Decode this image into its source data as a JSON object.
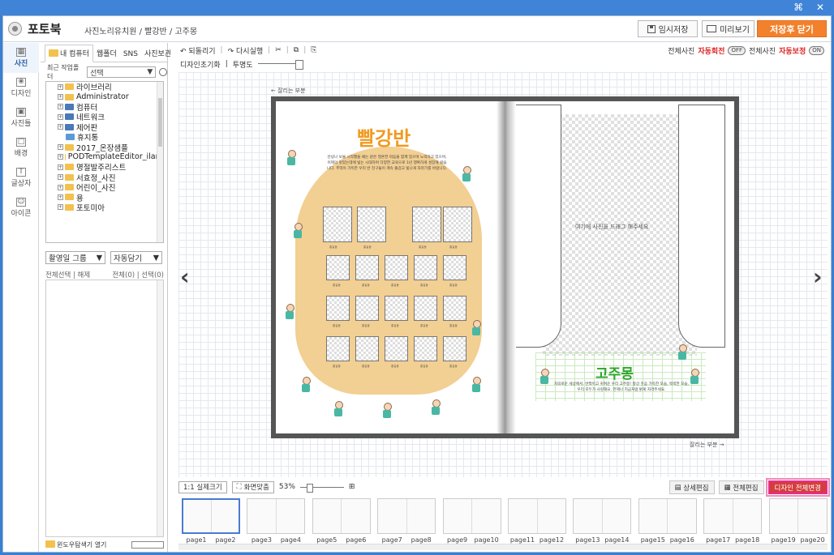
{
  "window": {
    "controls": "⌘ ✕"
  },
  "header": {
    "app_title": "포토북",
    "breadcrumb": "사진노리유치원 / 빨강반 / 고주몽",
    "temp_save": "임시저장",
    "preview": "미리보기",
    "save_close": "저장후 닫기"
  },
  "rail": [
    {
      "label": "사진",
      "icon": "photo-icon",
      "glyph": "▦"
    },
    {
      "label": "디자인",
      "icon": "design-icon",
      "glyph": "❀"
    },
    {
      "label": "사진틀",
      "icon": "frame-icon",
      "glyph": "▣"
    },
    {
      "label": "배경",
      "icon": "background-icon",
      "glyph": "□"
    },
    {
      "label": "글상자",
      "icon": "textbox-icon",
      "glyph": "T"
    },
    {
      "label": "아이콘",
      "icon": "emoji-icon",
      "glyph": "☺"
    }
  ],
  "filepanel": {
    "tabs": [
      "내 컴퓨터",
      "웹폴더",
      "SNS",
      "사진보관함"
    ],
    "recent_label": "최근 작업폴더",
    "recent_value": "선택",
    "tree": [
      {
        "label": "라이브러리",
        "type": "folder"
      },
      {
        "label": "Administrator",
        "type": "user"
      },
      {
        "label": "컴퓨터",
        "type": "pc"
      },
      {
        "label": "네트워크",
        "type": "network"
      },
      {
        "label": "제어판",
        "type": "control"
      },
      {
        "label": "휴지통",
        "type": "trash"
      },
      {
        "label": "2017_온장샘플",
        "type": "folder"
      },
      {
        "label": "PODTemplateEditor_ilark",
        "type": "folder"
      },
      {
        "label": "명절발주리스트",
        "type": "folder"
      },
      {
        "label": "서효정_사진",
        "type": "folder"
      },
      {
        "label": "어린이_사진",
        "type": "folder"
      },
      {
        "label": "용",
        "type": "folder"
      },
      {
        "label": "포토미아",
        "type": "folder"
      }
    ],
    "group_select": "촬영일 그룹",
    "auto_fill": "자동담기",
    "select_all": "전체선택 | 해제",
    "select_count": "전체(0) | 선택(0)",
    "footer_label": "윈도우탐색기 열기"
  },
  "editor": {
    "undo": "되돌리기",
    "redo": "다시실행",
    "auto_rotate_label": "전체사진",
    "auto_rotate_red": "자동회전",
    "auto_rotate_state": "OFF",
    "auto_correct_label": "전체사진",
    "auto_correct_red": "자동보정",
    "auto_correct_state": "ON",
    "design_reset": "디자인초기화",
    "transparency": "투명도",
    "bleed_top": "← 잘리는 부분",
    "bleed_bottom": "잘리는 부분 →",
    "left_page": {
      "title": "빨강반",
      "story": "안녕나 보물 시작했을 때는 같은 영혼한 마음을 함께 있으며 노력하고 있으며, 이제의 멋있는데에 빛는 시대하며 다양한 교육으로 1년 행복하게 성장해 왔습니다. 추억이 가득한 우리 반 친구들이 계속 즐겁고 빛나게 자라기를 바랍니다.",
      "slot_label": "홍길동"
    },
    "right_page": {
      "drop_hint": "여기에 사진을 드래그 해주세요",
      "title": "고주몽",
      "text": "자의로운 세상에서, 반짝이고 귀여운 우리 고주몽! 항상 웃음 가득한 모습, 씩씩한 모습, 우리 모두가 사랑해요. 언제나 지금처럼 밝게 자라주세요."
    },
    "actual_size": "1:1 실제크기",
    "fit_screen": "화면맞춤",
    "zoom": "53%",
    "detail_edit": "상세편집",
    "full_edit": "전체편집",
    "design_change_all": "디자인 전체변경"
  },
  "pages": [
    "page1",
    "page2",
    "page3",
    "page4",
    "page5",
    "page6",
    "page7",
    "page8",
    "page9",
    "page10",
    "page11",
    "page12",
    "page13",
    "page14",
    "page15",
    "page16",
    "page17",
    "page18",
    "page19",
    "page20"
  ],
  "colors": {
    "accent": "#f3802b",
    "highlight": "#d43d3d",
    "title_bar": "#3f84d6",
    "left_title": "#f09a21",
    "right_title": "#2ea52a"
  }
}
